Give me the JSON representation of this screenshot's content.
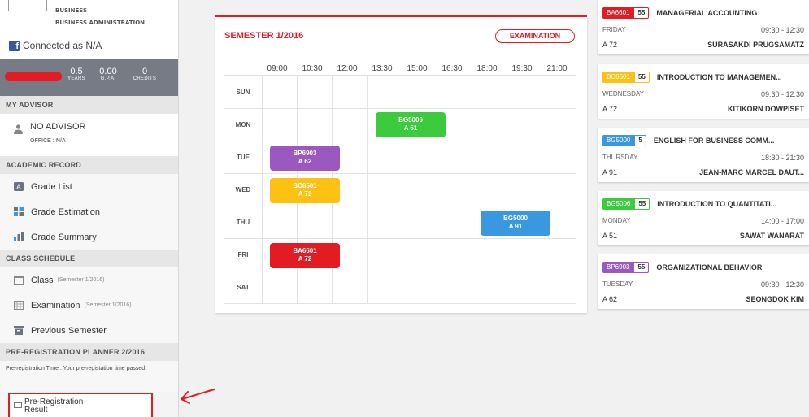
{
  "sidebar": {
    "faculty_line1": "BUSINESS",
    "faculty_line2": "BUSINESS ADMINISTRATION",
    "connected": "Connected as N/A",
    "stats": [
      {
        "value": "0.5",
        "label": "YEARS"
      },
      {
        "value": "0.00",
        "label": "G.P.A."
      },
      {
        "value": "0",
        "label": "CREDITS"
      }
    ],
    "my_advisor_head": "MY ADVISOR",
    "advisor_name": "NO ADVISOR",
    "advisor_office": "OFFICE : N/A",
    "academic_record_head": "ACADEMIC RECORD",
    "grade_list": "Grade List",
    "grade_estimation": "Grade Estimation",
    "grade_summary": "Grade Summary",
    "class_schedule_head": "CLASS SCHEDULE",
    "class_label": "Class",
    "class_sem": "(Semester 1/2016)",
    "exam_label": "Examination",
    "exam_sem": "(Semester 1/2016)",
    "previous_semester": "Previous Semester",
    "prereg_head": "PRE-REGISTRATION PLANNER 2/2016",
    "prereg_note": "Pre-registration Time : Your pre-registation time passed.",
    "prereg_result_line1": "Pre-Registration",
    "prereg_result_line2": "Result"
  },
  "schedule": {
    "title": "SEMESTER 1/2016",
    "exam_button": "EXAMINATION",
    "times": [
      "09:00",
      "10:30",
      "12:00",
      "13:30",
      "15:00",
      "16:30",
      "18:00",
      "19:30",
      "21:00"
    ],
    "days": [
      "SUN",
      "MON",
      "TUE",
      "WED",
      "THU",
      "FRI",
      "SAT"
    ],
    "events": [
      {
        "code": "BG5006",
        "room": "A 51",
        "color": "#3ccb3c"
      },
      {
        "code": "BP6903",
        "room": "A 62",
        "color": "#9b59c0"
      },
      {
        "code": "BC6501",
        "room": "A 72",
        "color": "#fcc113"
      },
      {
        "code": "BG5000",
        "room": "A 91",
        "color": "#3a98e0"
      },
      {
        "code": "BA6601",
        "room": "A 72",
        "color": "#e31b23"
      }
    ]
  },
  "courses": [
    {
      "code": "BA6601",
      "section": "55",
      "title": "MANAGERIAL ACCOUNTING",
      "day": "FRIDAY",
      "time": "09:30 - 12:30",
      "room": "A 72",
      "instructor": "SURASAKDI PRUGSAMATZ",
      "color": "#e31b23"
    },
    {
      "code": "BC6501",
      "section": "55",
      "title": "INTRODUCTION TO MANAGEMEN...",
      "day": "WEDNESDAY",
      "time": "09:30 - 12:30",
      "room": "A 72",
      "instructor": "KITIKORN DOWPISET",
      "color": "#fcc113"
    },
    {
      "code": "BG5000",
      "section": "5",
      "title": "ENGLISH FOR BUSINESS COMM...",
      "day": "THURSDAY",
      "time": "18:30 - 21:30",
      "room": "A 91",
      "instructor": "JEAN-MARC MARCEL DAUT...",
      "color": "#3a98e0"
    },
    {
      "code": "BG5006",
      "section": "55",
      "title": "INTRODUCTION TO QUANTITATI...",
      "day": "MONDAY",
      "time": "14:00 - 17:00",
      "room": "A 51",
      "instructor": "SAWAT WANARAT",
      "color": "#3ccb3c"
    },
    {
      "code": "BP6903",
      "section": "55",
      "title": "ORGANIZATIONAL BEHAVIOR",
      "day": "TUESDAY",
      "time": "09:30 - 12:30",
      "room": "A 62",
      "instructor": "SEONGDOK KIM",
      "color": "#9b59c0"
    }
  ]
}
